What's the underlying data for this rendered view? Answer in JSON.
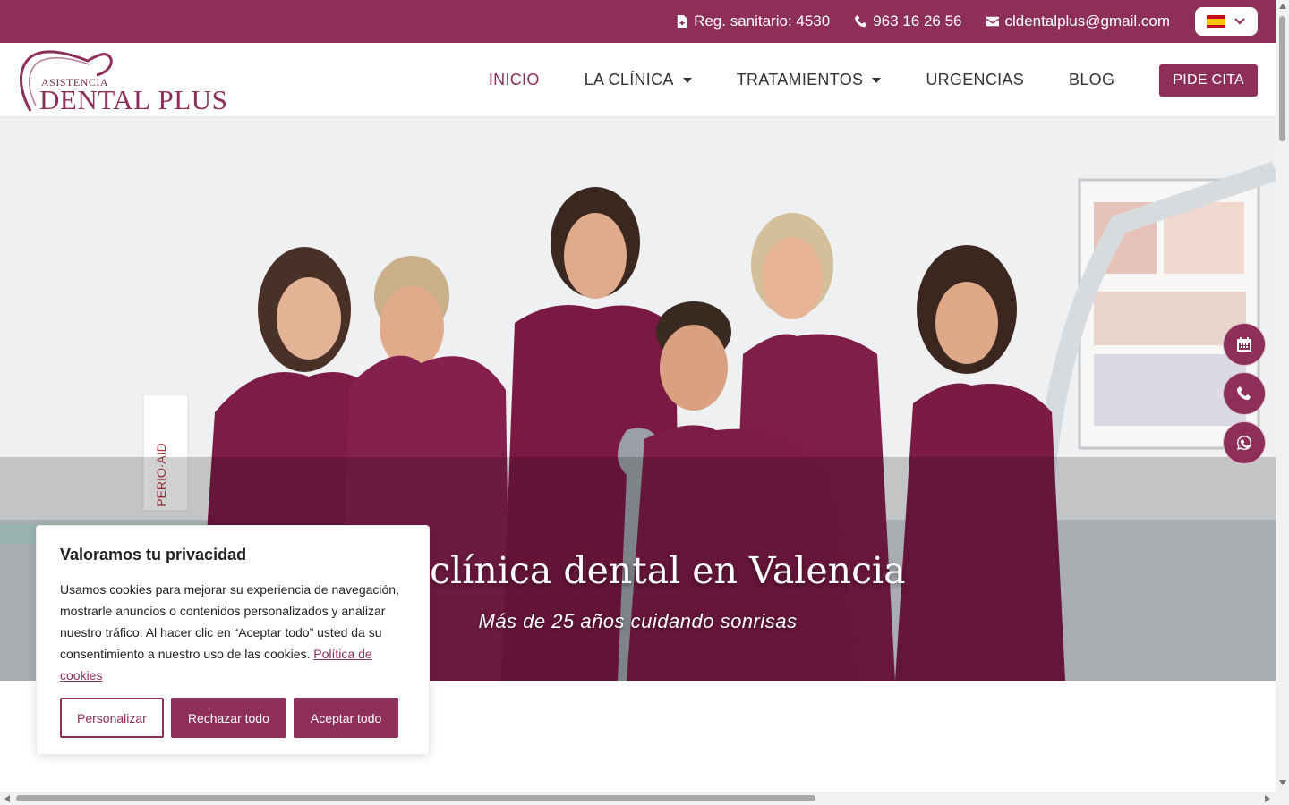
{
  "topbar": {
    "registry": "Reg. sanitario: 4530",
    "phone": "963 16 26 56",
    "email": "cldentalplus@gmail.com",
    "language_flag": "es-flag-icon"
  },
  "logo": {
    "small": "ASISTENCIA",
    "main": "DENTAL",
    "accent": "PLUS"
  },
  "nav": {
    "items": [
      {
        "label": "INICIO",
        "active": true
      },
      {
        "label": "LA CLÍNICA",
        "dropdown": true
      },
      {
        "label": "TRATAMIENTOS",
        "dropdown": true
      },
      {
        "label": "URGENCIAS"
      },
      {
        "label": "BLOG"
      }
    ],
    "cta": "PIDE CITA"
  },
  "hero": {
    "title": "Tu clínica dental en Valencia",
    "subtitle": "Más de 25 años cuidando sonrisas",
    "product_label": "PERIO·AID"
  },
  "floating": [
    "calendar-icon",
    "phone-icon",
    "whatsapp-icon"
  ],
  "cookie": {
    "title": "Valoramos tu privacidad",
    "text": "Usamos cookies para mejorar su experiencia de navegación, mostrarle anuncios o contenidos personalizados y analizar nuestro tráfico. Al hacer clic en “Aceptar todo” usted da su consentimiento a nuestro uso de las cookies.",
    "link": "Política de cookies",
    "buttons": {
      "customize": "Personalizar",
      "reject": "Rechazar todo",
      "accept": "Aceptar todo"
    }
  },
  "colors": {
    "brand": "#8e2f5a",
    "text": "#333333"
  }
}
